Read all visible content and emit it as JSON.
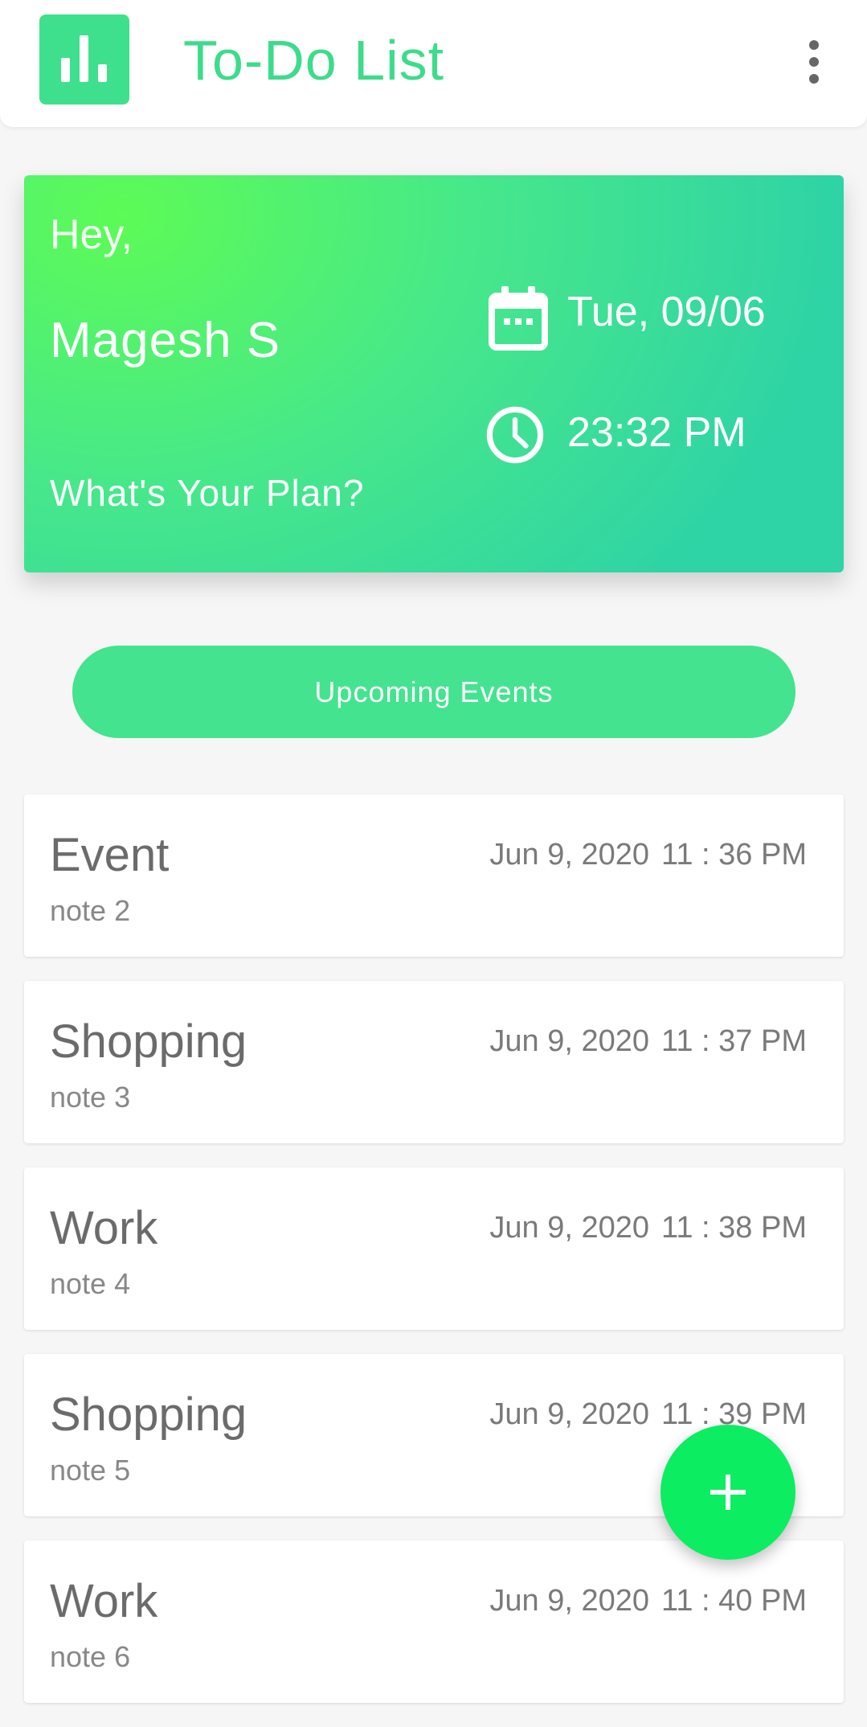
{
  "app_bar": {
    "title": "To-Do List",
    "logo_icon": "bar-chart-icon",
    "menu_icon": "more-vert-icon"
  },
  "hero": {
    "greeting": "Hey,",
    "user_name": "Magesh S",
    "prompt": "What's Your Plan?",
    "date": "Tue, 09/06",
    "time": "23:32 PM",
    "date_icon": "calendar-icon",
    "time_icon": "clock-icon"
  },
  "upcoming_button": {
    "label": "Upcoming Events"
  },
  "events": [
    {
      "title": "Event",
      "note": "note 2",
      "date": "Jun 9, 2020",
      "time": "11 : 36 PM"
    },
    {
      "title": "Shopping",
      "note": "note 3",
      "date": "Jun 9, 2020",
      "time": "11 : 37 PM"
    },
    {
      "title": "Work",
      "note": "note 4",
      "date": "Jun 9, 2020",
      "time": "11 : 38 PM"
    },
    {
      "title": "Shopping",
      "note": "note 5",
      "date": "Jun 9, 2020",
      "time": "11 : 39 PM"
    },
    {
      "title": "Work",
      "note": "note 6",
      "date": "Jun 9, 2020",
      "time": "11 : 40 PM"
    }
  ],
  "fab": {
    "icon": "add-icon"
  },
  "colors": {
    "accent": "#3ddc8b",
    "fab": "#0ced61",
    "gradient_start": "#5dfb56",
    "gradient_end": "#2ed3a6"
  }
}
